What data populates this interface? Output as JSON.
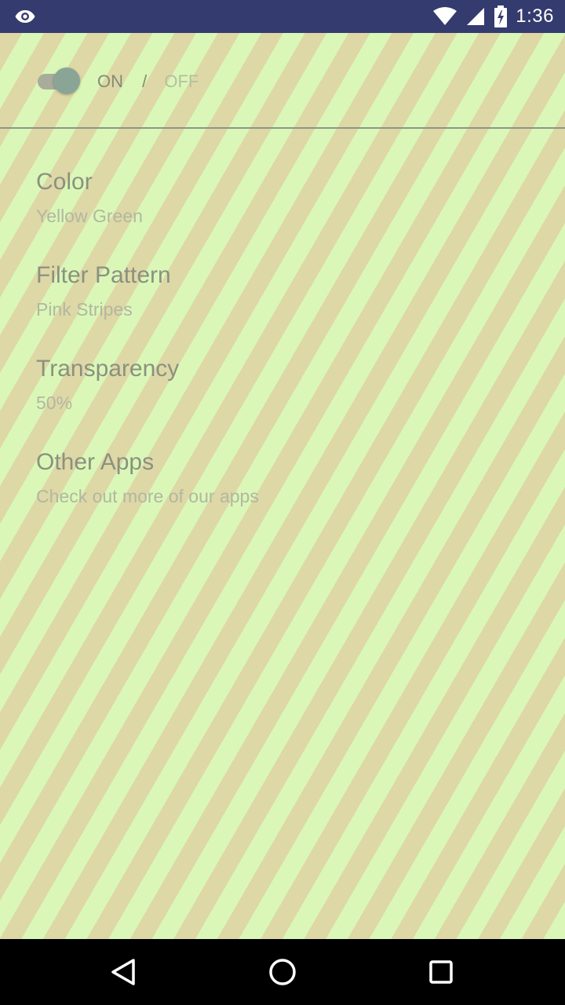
{
  "status_bar": {
    "time": "1:36",
    "icons": [
      "eye-icon",
      "wifi-icon",
      "cellular-signal-icon",
      "battery-charging-icon"
    ],
    "background_color": "#343b6f"
  },
  "toggle": {
    "on_label": "ON",
    "separator": "/",
    "off_label": "OFF",
    "state": "on"
  },
  "settings": [
    {
      "title": "Color",
      "summary": "Yellow Green"
    },
    {
      "title": "Filter Pattern",
      "summary": "Pink Stripes"
    },
    {
      "title": "Transparency",
      "summary": "50%"
    },
    {
      "title": "Other Apps",
      "summary": "Check out more of our apps"
    }
  ],
  "nav_bar": {
    "buttons": [
      "back-icon",
      "home-icon",
      "recents-icon"
    ]
  },
  "colors": {
    "stripe_light": "#daf7b8",
    "stripe_dark": "#ddd8a6"
  }
}
